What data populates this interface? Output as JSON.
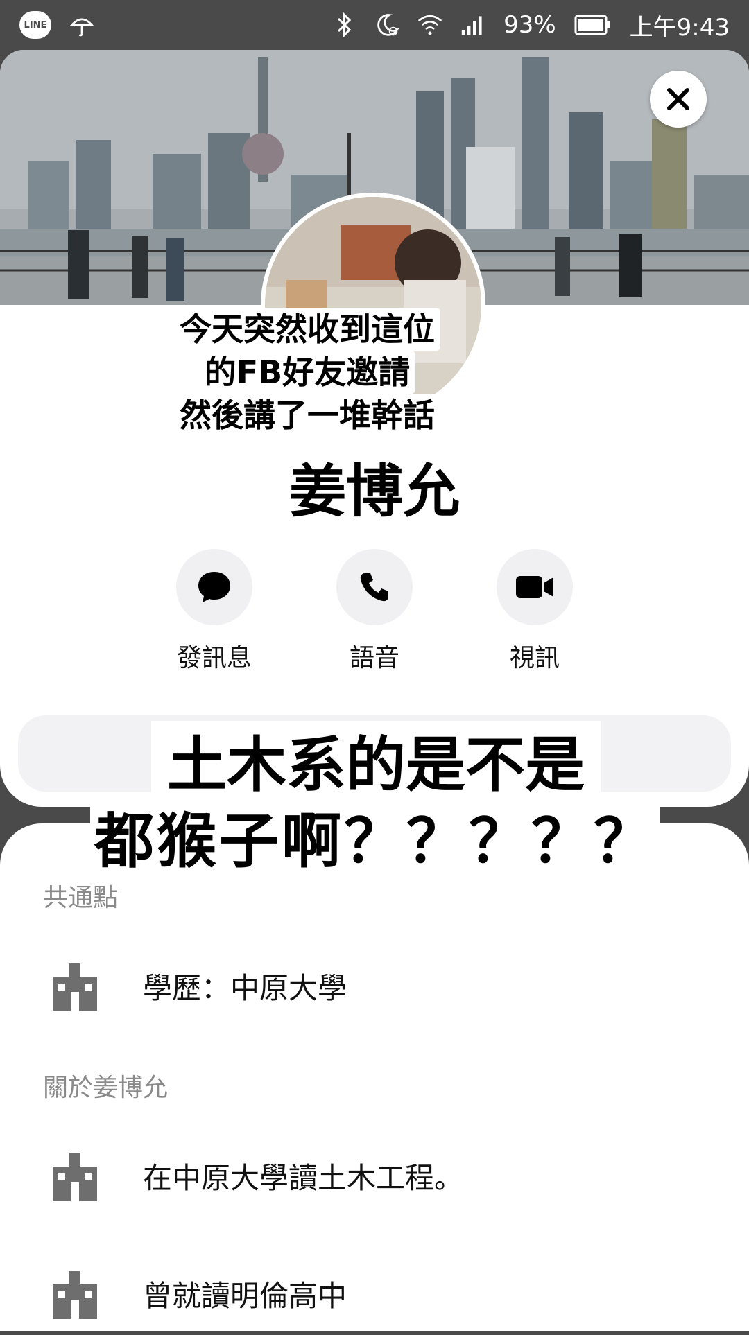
{
  "status_bar": {
    "line_label": "LINE",
    "battery_percent": "93%",
    "time": "上午9:43"
  },
  "overlay_caption": {
    "lines": [
      "今天突然收到這位",
      "的FB好友邀請",
      "然後講了一堆幹話"
    ]
  },
  "profile": {
    "name": "姜博允"
  },
  "actions": [
    {
      "label": "發訊息",
      "icon": "message-bubble-icon"
    },
    {
      "label": "語音",
      "icon": "phone-icon"
    },
    {
      "label": "視訊",
      "icon": "video-camera-icon"
    }
  ],
  "big_caption": {
    "line1": "土木系的是不是",
    "line2": "都猴子啊？？？？？"
  },
  "info": {
    "common_header": "共通點",
    "common_items": [
      {
        "text": "學歷：中原大學",
        "icon": "school-building-icon"
      }
    ],
    "about_header": "關於姜博允",
    "about_items": [
      {
        "text": "在中原大學讀土木工程。",
        "icon": "school-building-icon"
      },
      {
        "text": "曾就讀明倫高中",
        "icon": "school-building-icon"
      }
    ]
  },
  "colors": {
    "status_bar_bg": "#4a4a4a",
    "action_circle_bg": "#f0f0f2",
    "section_header": "#8a8a8a",
    "icon_gray": "#6e6e6e"
  }
}
